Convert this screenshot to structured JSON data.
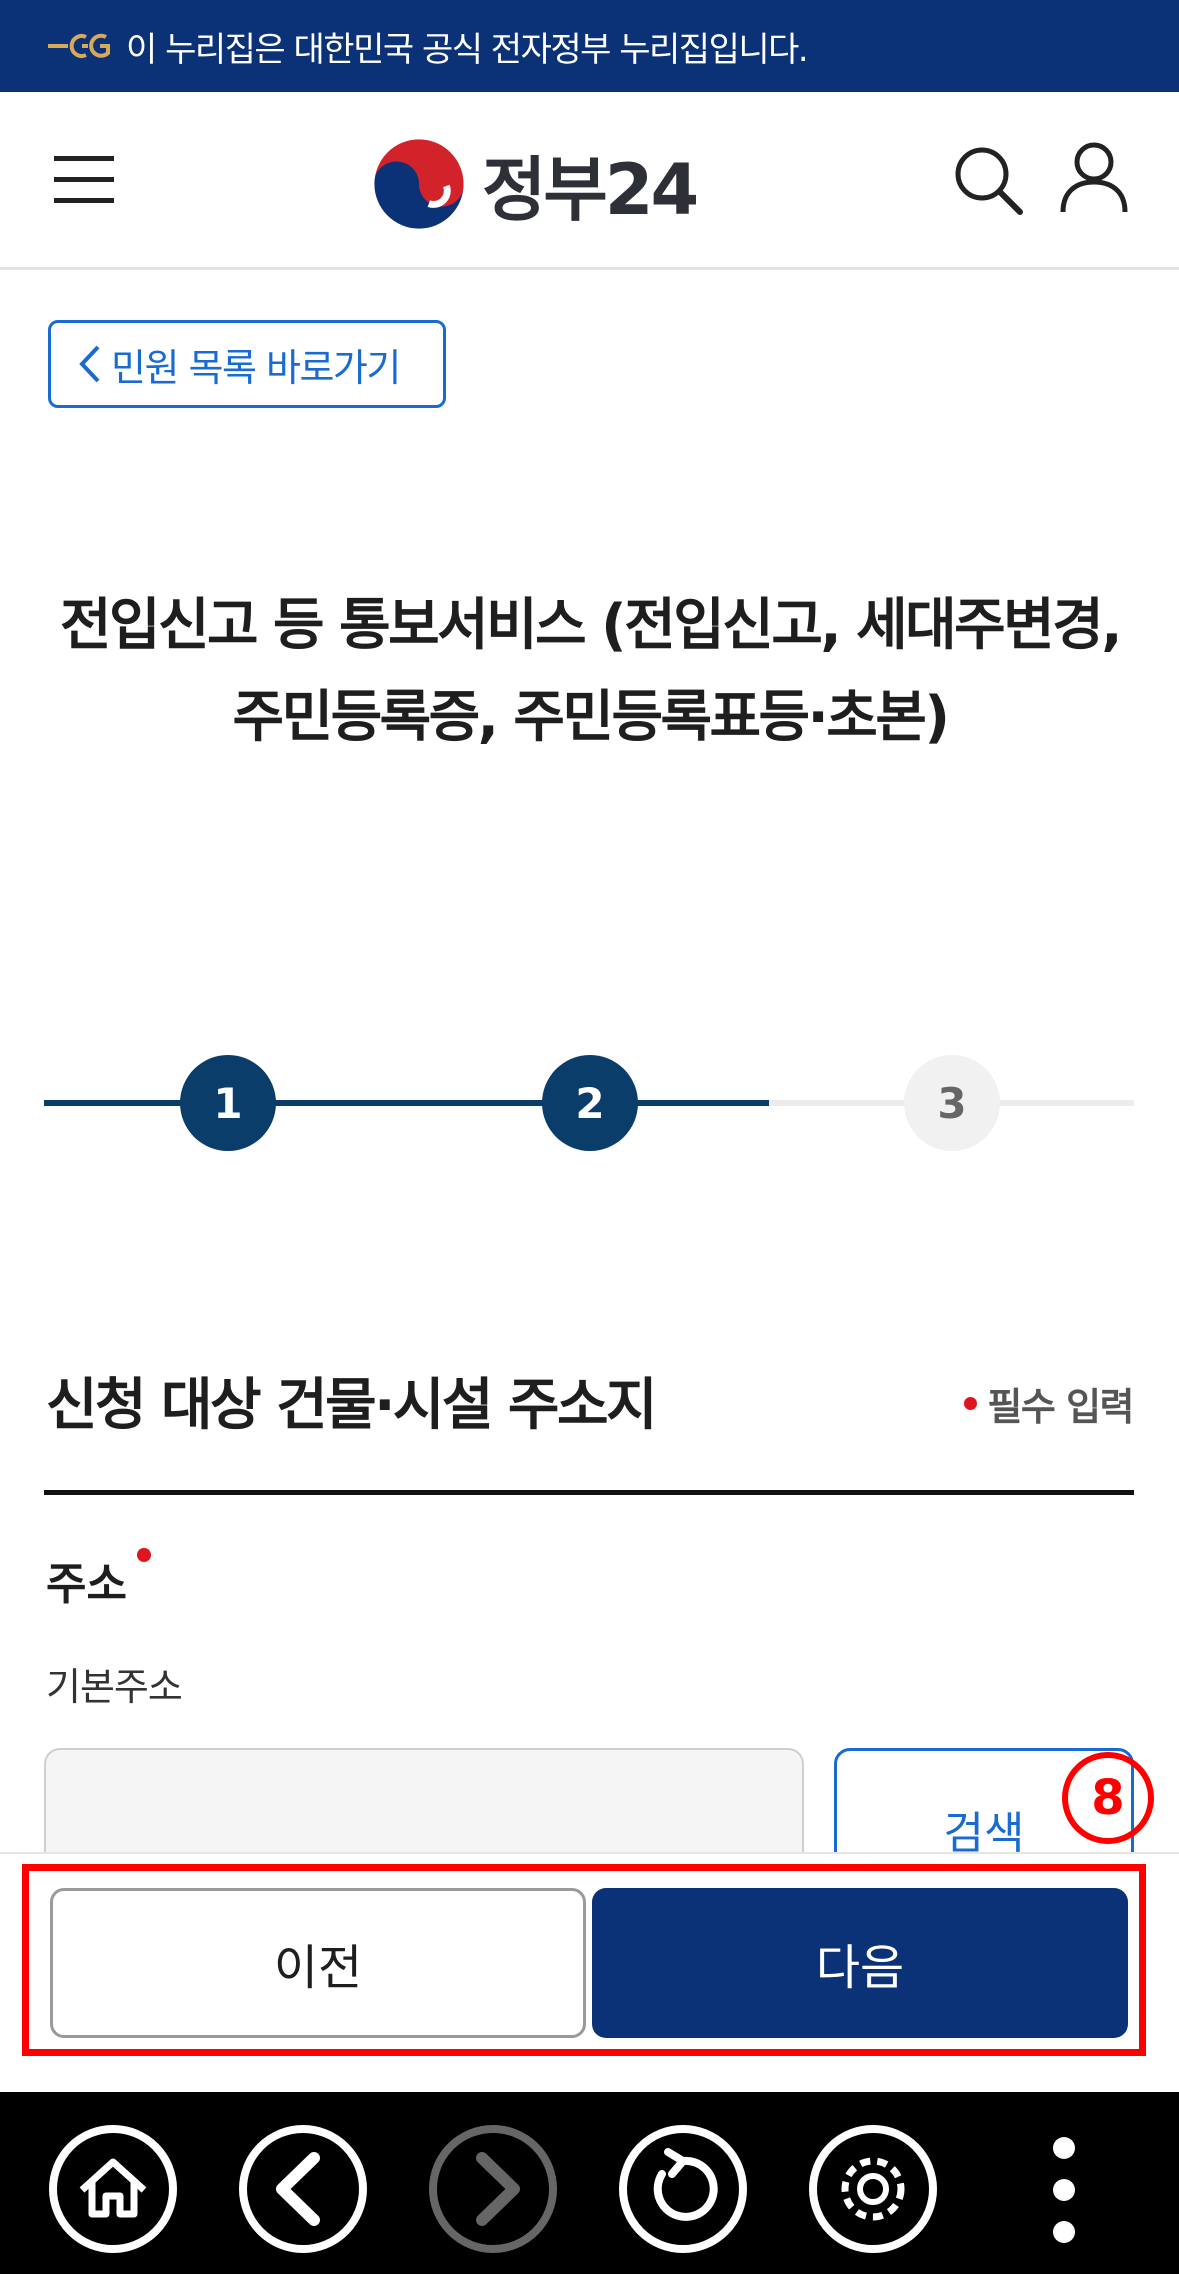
{
  "gov_banner": {
    "text": "이 누리집은 대한민국 공식 전자정부 누리집입니다.",
    "icon": "eg-mark-icon"
  },
  "header": {
    "menu_icon": "hamburger-icon",
    "logo_text": "정부24",
    "search_icon": "search-icon",
    "user_icon": "user-icon"
  },
  "back_link": {
    "label": "민원 목록 바로가기",
    "icon": "chevron-left-icon"
  },
  "page": {
    "title_line1": "전입신고 등 통보서비스 (전입신고, 세대주변경,",
    "title_line2": "주민등록증, 주민등록표등·초본)"
  },
  "steps": [
    {
      "label": "1",
      "state": "done"
    },
    {
      "label": "2",
      "state": "current"
    },
    {
      "label": "3",
      "state": "todo"
    }
  ],
  "section": {
    "title": "신청 대상 건물·시설 주소지",
    "required_legend": "필수 입력"
  },
  "address": {
    "label": "주소",
    "sub_label": "기본주소",
    "input_value": "",
    "search_label": "검색"
  },
  "annotation": {
    "number": "8"
  },
  "footer": {
    "prev_label": "이전",
    "next_label": "다음"
  },
  "navbar": {
    "icons": [
      "home-icon",
      "back-icon",
      "forward-icon",
      "refresh-icon",
      "settings-icon",
      "more-icon"
    ]
  },
  "colors": {
    "brand_navy": "#0b3277",
    "step_navy": "#0b3d6b",
    "link_blue": "#1a6bd1",
    "required_red": "#e0141e",
    "annotation_red": "#ff0000"
  }
}
